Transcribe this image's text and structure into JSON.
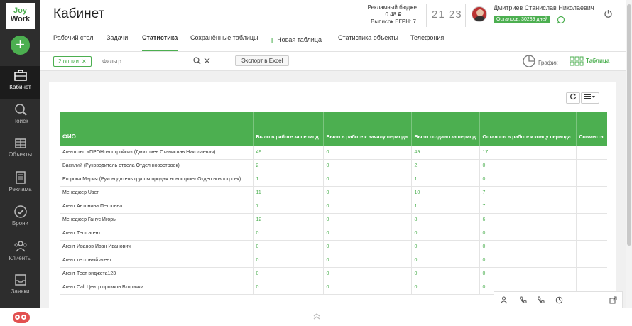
{
  "logo": {
    "line1": "Joy",
    "line2": "Work"
  },
  "sidebar": {
    "items": [
      {
        "label": "Кабинет",
        "icon": "briefcase-icon"
      },
      {
        "label": "Поиск",
        "icon": "search-icon"
      },
      {
        "label": "Объекты",
        "icon": "building-icon"
      },
      {
        "label": "Реклама",
        "icon": "document-icon"
      },
      {
        "label": "Брони",
        "icon": "check-circle-icon"
      },
      {
        "label": "Клиенты",
        "icon": "users-icon"
      },
      {
        "label": "Заявки",
        "icon": "inbox-icon"
      }
    ]
  },
  "header": {
    "title": "Кабинет",
    "budget_label": "Рекламный бюджет",
    "budget_value": "0.48 ₽",
    "egrn": "Выписок ЕГРН: 7",
    "clock": "21 23",
    "user_name": "Дмитриев Станислав Николаевич",
    "days_left": "Осталось: 30239 дней"
  },
  "tabs": [
    {
      "label": "Рабочий стол"
    },
    {
      "label": "Задачи"
    },
    {
      "label": "Статистика"
    },
    {
      "label": "Сохранённые таблицы"
    },
    {
      "label": "Новая таблица"
    },
    {
      "label": "Статистика объекты"
    },
    {
      "label": "Телефония"
    }
  ],
  "filter": {
    "chip_label": "2 опции",
    "placeholder": "Фильтр",
    "export_label": "Экспорт в Excel",
    "view_chart_label": "График",
    "view_table_label": "Таблица"
  },
  "table": {
    "columns": [
      "ФИО",
      "Было в работе за период",
      "Было в работе к началу периода",
      "Было создано за период",
      "Осталось в работе к концу периода",
      "Совместн"
    ],
    "rows": [
      [
        "Агентство «ПРОНовостройки» (Дмитриев Станислав Николаевич)",
        "49",
        "0",
        "49",
        "17"
      ],
      [
        "Василий (Руководитель отдела Отдел новостроек)",
        "2",
        "0",
        "2",
        "0"
      ],
      [
        "Егорова Мария (Руководитель группы продаж новостроек Отдел новостроек)",
        "1",
        "0",
        "1",
        "0"
      ],
      [
        "Менеджер User",
        "11",
        "0",
        "10",
        "7"
      ],
      [
        "Агент Антонина Петровна",
        "7",
        "0",
        "1",
        "7"
      ],
      [
        "Менеджер Ганус Игорь",
        "12",
        "0",
        "8",
        "6"
      ],
      [
        "Агент Тест агент",
        "0",
        "0",
        "0",
        "0"
      ],
      [
        "Агент Иванов Иван Иванович",
        "0",
        "0",
        "0",
        "0"
      ],
      [
        "Агент тестовый агент",
        "0",
        "0",
        "0",
        "0"
      ],
      [
        "Агент Тест виджета123",
        "0",
        "0",
        "0",
        "0"
      ],
      [
        "Агент Call Центр прозвон Вторички",
        "0",
        "0",
        "0",
        "0"
      ]
    ]
  },
  "colors": {
    "accent": "#4caf50",
    "sidebar": "#2d2d2d",
    "record": "#e25050"
  }
}
